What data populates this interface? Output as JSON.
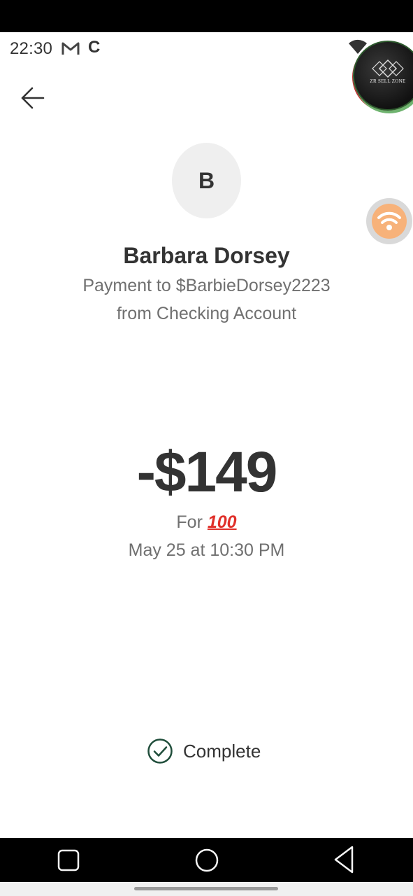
{
  "status_bar": {
    "time": "22:30",
    "icons": [
      "gmail-icon",
      "c-icon",
      "wifi-icon"
    ],
    "c_glyph": "C"
  },
  "overlay_logo": {
    "text": "ZR SELL ZONE"
  },
  "header": {
    "back_icon": "arrow-left-icon"
  },
  "floating_button": {
    "icon": "wifi-icon",
    "color": "#f7b27a"
  },
  "recipient": {
    "avatar_initial": "B",
    "name": "Barbara Dorsey",
    "payment_line": "Payment to $BarbieDorsey2223",
    "account_line": "from Checking Account"
  },
  "transaction": {
    "amount": "-$149",
    "for_label": "For",
    "for_emoji": "100",
    "date": "May 25 at 10:30 PM"
  },
  "status": {
    "label": "Complete",
    "icon": "check-circle-icon",
    "color": "#1f4d3a"
  },
  "nav_bar": {
    "buttons": [
      "recents-icon",
      "home-icon",
      "back-icon"
    ]
  }
}
